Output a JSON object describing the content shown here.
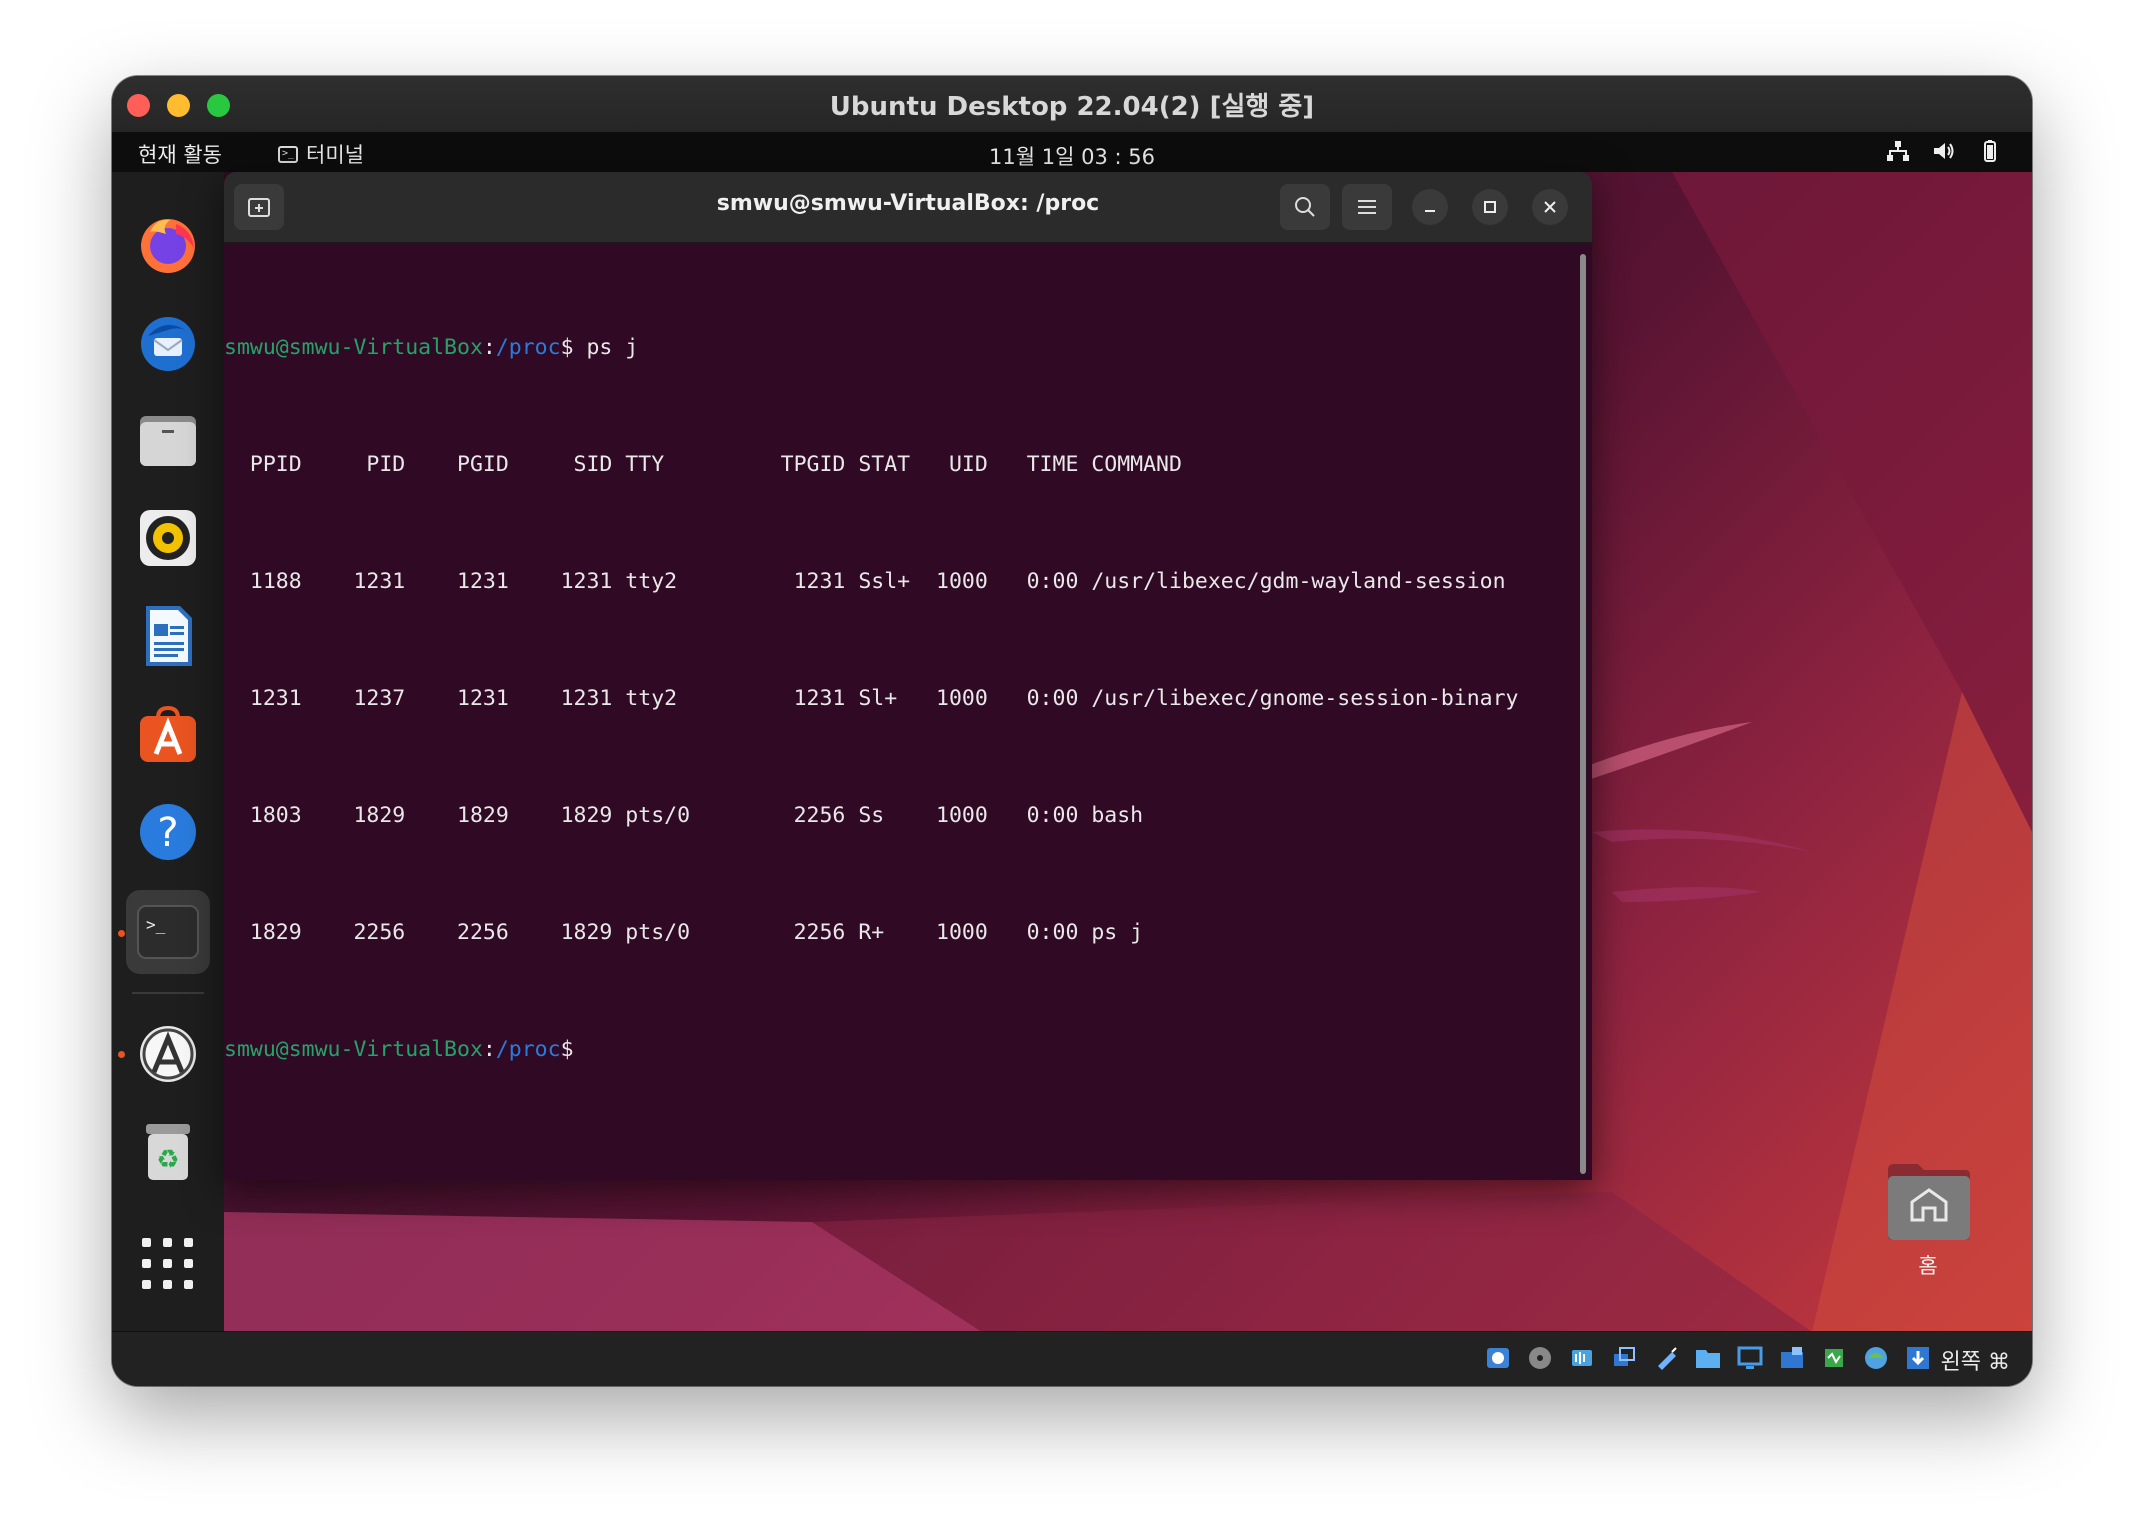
{
  "host_window": {
    "title": "Ubuntu Desktop 22.04(2) [실행 중]"
  },
  "topbar": {
    "activities": "현재 활동",
    "app_name": "터미널",
    "clock": "11월 1일 03 : 56"
  },
  "dock": {
    "items": [
      {
        "icon": "firefox-icon"
      },
      {
        "icon": "thunderbird-icon"
      },
      {
        "icon": "files-icon"
      },
      {
        "icon": "rhythmbox-icon"
      },
      {
        "icon": "libreoffice-writer-icon"
      },
      {
        "icon": "app-center-icon"
      },
      {
        "icon": "help-icon"
      },
      {
        "icon": "terminal-icon",
        "active": true
      },
      {
        "icon": "software-updater-icon"
      },
      {
        "icon": "trash-icon"
      },
      {
        "icon": "show-apps-icon"
      }
    ]
  },
  "desktop": {
    "home_label": "홈"
  },
  "terminal": {
    "title": "smwu@smwu-VirtualBox: /proc",
    "prompt_user": "smwu@smwu-VirtualBox",
    "prompt_sep": ":",
    "prompt_path": "/proc",
    "prompt_end": "$",
    "command": " ps j",
    "headers": [
      "PPID",
      "PID",
      "PGID",
      "SID",
      "TTY",
      "TPGID",
      "STAT",
      "UID",
      "TIME",
      "COMMAND"
    ],
    "rows": [
      [
        "1188",
        "1231",
        "1231",
        "1231",
        "tty2",
        "1231",
        "Ssl+",
        "1000",
        "0:00",
        "/usr/libexec/gdm-wayland-session"
      ],
      [
        "1231",
        "1237",
        "1231",
        "1231",
        "tty2",
        "1231",
        "Sl+",
        "1000",
        "0:00",
        "/usr/libexec/gnome-session-binary"
      ],
      [
        "1803",
        "1829",
        "1829",
        "1829",
        "pts/0",
        "2256",
        "Ss",
        "1000",
        "0:00",
        "bash"
      ],
      [
        "1829",
        "2256",
        "2256",
        "1829",
        "pts/0",
        "2256",
        "R+",
        "1000",
        "0:00",
        "ps j"
      ]
    ]
  },
  "statusbar": {
    "host_key": "왼쪽 ⌘"
  },
  "colors": {
    "terminal_bg": "#300a24",
    "prompt_user": "#26a269",
    "prompt_path": "#2a7bde",
    "accent": "#e95420"
  }
}
